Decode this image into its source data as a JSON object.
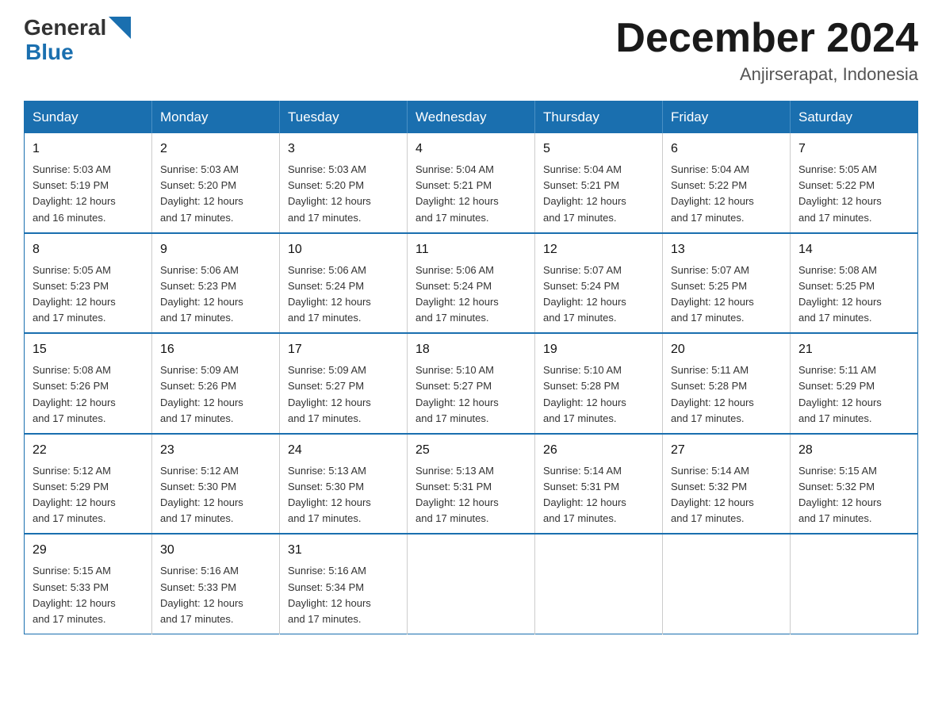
{
  "header": {
    "logo_general": "General",
    "logo_blue": "Blue",
    "title": "December 2024",
    "subtitle": "Anjirserapat, Indonesia"
  },
  "weekdays": [
    "Sunday",
    "Monday",
    "Tuesday",
    "Wednesday",
    "Thursday",
    "Friday",
    "Saturday"
  ],
  "weeks": [
    [
      {
        "day": "1",
        "sunrise": "5:03 AM",
        "sunset": "5:19 PM",
        "daylight": "12 hours and 16 minutes."
      },
      {
        "day": "2",
        "sunrise": "5:03 AM",
        "sunset": "5:20 PM",
        "daylight": "12 hours and 17 minutes."
      },
      {
        "day": "3",
        "sunrise": "5:03 AM",
        "sunset": "5:20 PM",
        "daylight": "12 hours and 17 minutes."
      },
      {
        "day": "4",
        "sunrise": "5:04 AM",
        "sunset": "5:21 PM",
        "daylight": "12 hours and 17 minutes."
      },
      {
        "day": "5",
        "sunrise": "5:04 AM",
        "sunset": "5:21 PM",
        "daylight": "12 hours and 17 minutes."
      },
      {
        "day": "6",
        "sunrise": "5:04 AM",
        "sunset": "5:22 PM",
        "daylight": "12 hours and 17 minutes."
      },
      {
        "day": "7",
        "sunrise": "5:05 AM",
        "sunset": "5:22 PM",
        "daylight": "12 hours and 17 minutes."
      }
    ],
    [
      {
        "day": "8",
        "sunrise": "5:05 AM",
        "sunset": "5:23 PM",
        "daylight": "12 hours and 17 minutes."
      },
      {
        "day": "9",
        "sunrise": "5:06 AM",
        "sunset": "5:23 PM",
        "daylight": "12 hours and 17 minutes."
      },
      {
        "day": "10",
        "sunrise": "5:06 AM",
        "sunset": "5:24 PM",
        "daylight": "12 hours and 17 minutes."
      },
      {
        "day": "11",
        "sunrise": "5:06 AM",
        "sunset": "5:24 PM",
        "daylight": "12 hours and 17 minutes."
      },
      {
        "day": "12",
        "sunrise": "5:07 AM",
        "sunset": "5:24 PM",
        "daylight": "12 hours and 17 minutes."
      },
      {
        "day": "13",
        "sunrise": "5:07 AM",
        "sunset": "5:25 PM",
        "daylight": "12 hours and 17 minutes."
      },
      {
        "day": "14",
        "sunrise": "5:08 AM",
        "sunset": "5:25 PM",
        "daylight": "12 hours and 17 minutes."
      }
    ],
    [
      {
        "day": "15",
        "sunrise": "5:08 AM",
        "sunset": "5:26 PM",
        "daylight": "12 hours and 17 minutes."
      },
      {
        "day": "16",
        "sunrise": "5:09 AM",
        "sunset": "5:26 PM",
        "daylight": "12 hours and 17 minutes."
      },
      {
        "day": "17",
        "sunrise": "5:09 AM",
        "sunset": "5:27 PM",
        "daylight": "12 hours and 17 minutes."
      },
      {
        "day": "18",
        "sunrise": "5:10 AM",
        "sunset": "5:27 PM",
        "daylight": "12 hours and 17 minutes."
      },
      {
        "day": "19",
        "sunrise": "5:10 AM",
        "sunset": "5:28 PM",
        "daylight": "12 hours and 17 minutes."
      },
      {
        "day": "20",
        "sunrise": "5:11 AM",
        "sunset": "5:28 PM",
        "daylight": "12 hours and 17 minutes."
      },
      {
        "day": "21",
        "sunrise": "5:11 AM",
        "sunset": "5:29 PM",
        "daylight": "12 hours and 17 minutes."
      }
    ],
    [
      {
        "day": "22",
        "sunrise": "5:12 AM",
        "sunset": "5:29 PM",
        "daylight": "12 hours and 17 minutes."
      },
      {
        "day": "23",
        "sunrise": "5:12 AM",
        "sunset": "5:30 PM",
        "daylight": "12 hours and 17 minutes."
      },
      {
        "day": "24",
        "sunrise": "5:13 AM",
        "sunset": "5:30 PM",
        "daylight": "12 hours and 17 minutes."
      },
      {
        "day": "25",
        "sunrise": "5:13 AM",
        "sunset": "5:31 PM",
        "daylight": "12 hours and 17 minutes."
      },
      {
        "day": "26",
        "sunrise": "5:14 AM",
        "sunset": "5:31 PM",
        "daylight": "12 hours and 17 minutes."
      },
      {
        "day": "27",
        "sunrise": "5:14 AM",
        "sunset": "5:32 PM",
        "daylight": "12 hours and 17 minutes."
      },
      {
        "day": "28",
        "sunrise": "5:15 AM",
        "sunset": "5:32 PM",
        "daylight": "12 hours and 17 minutes."
      }
    ],
    [
      {
        "day": "29",
        "sunrise": "5:15 AM",
        "sunset": "5:33 PM",
        "daylight": "12 hours and 17 minutes."
      },
      {
        "day": "30",
        "sunrise": "5:16 AM",
        "sunset": "5:33 PM",
        "daylight": "12 hours and 17 minutes."
      },
      {
        "day": "31",
        "sunrise": "5:16 AM",
        "sunset": "5:34 PM",
        "daylight": "12 hours and 17 minutes."
      },
      null,
      null,
      null,
      null
    ]
  ],
  "labels": {
    "sunrise": "Sunrise:",
    "sunset": "Sunset:",
    "daylight": "Daylight:"
  },
  "colors": {
    "header_bg": "#1a6faf",
    "header_text": "#ffffff",
    "border": "#1a6faf"
  }
}
